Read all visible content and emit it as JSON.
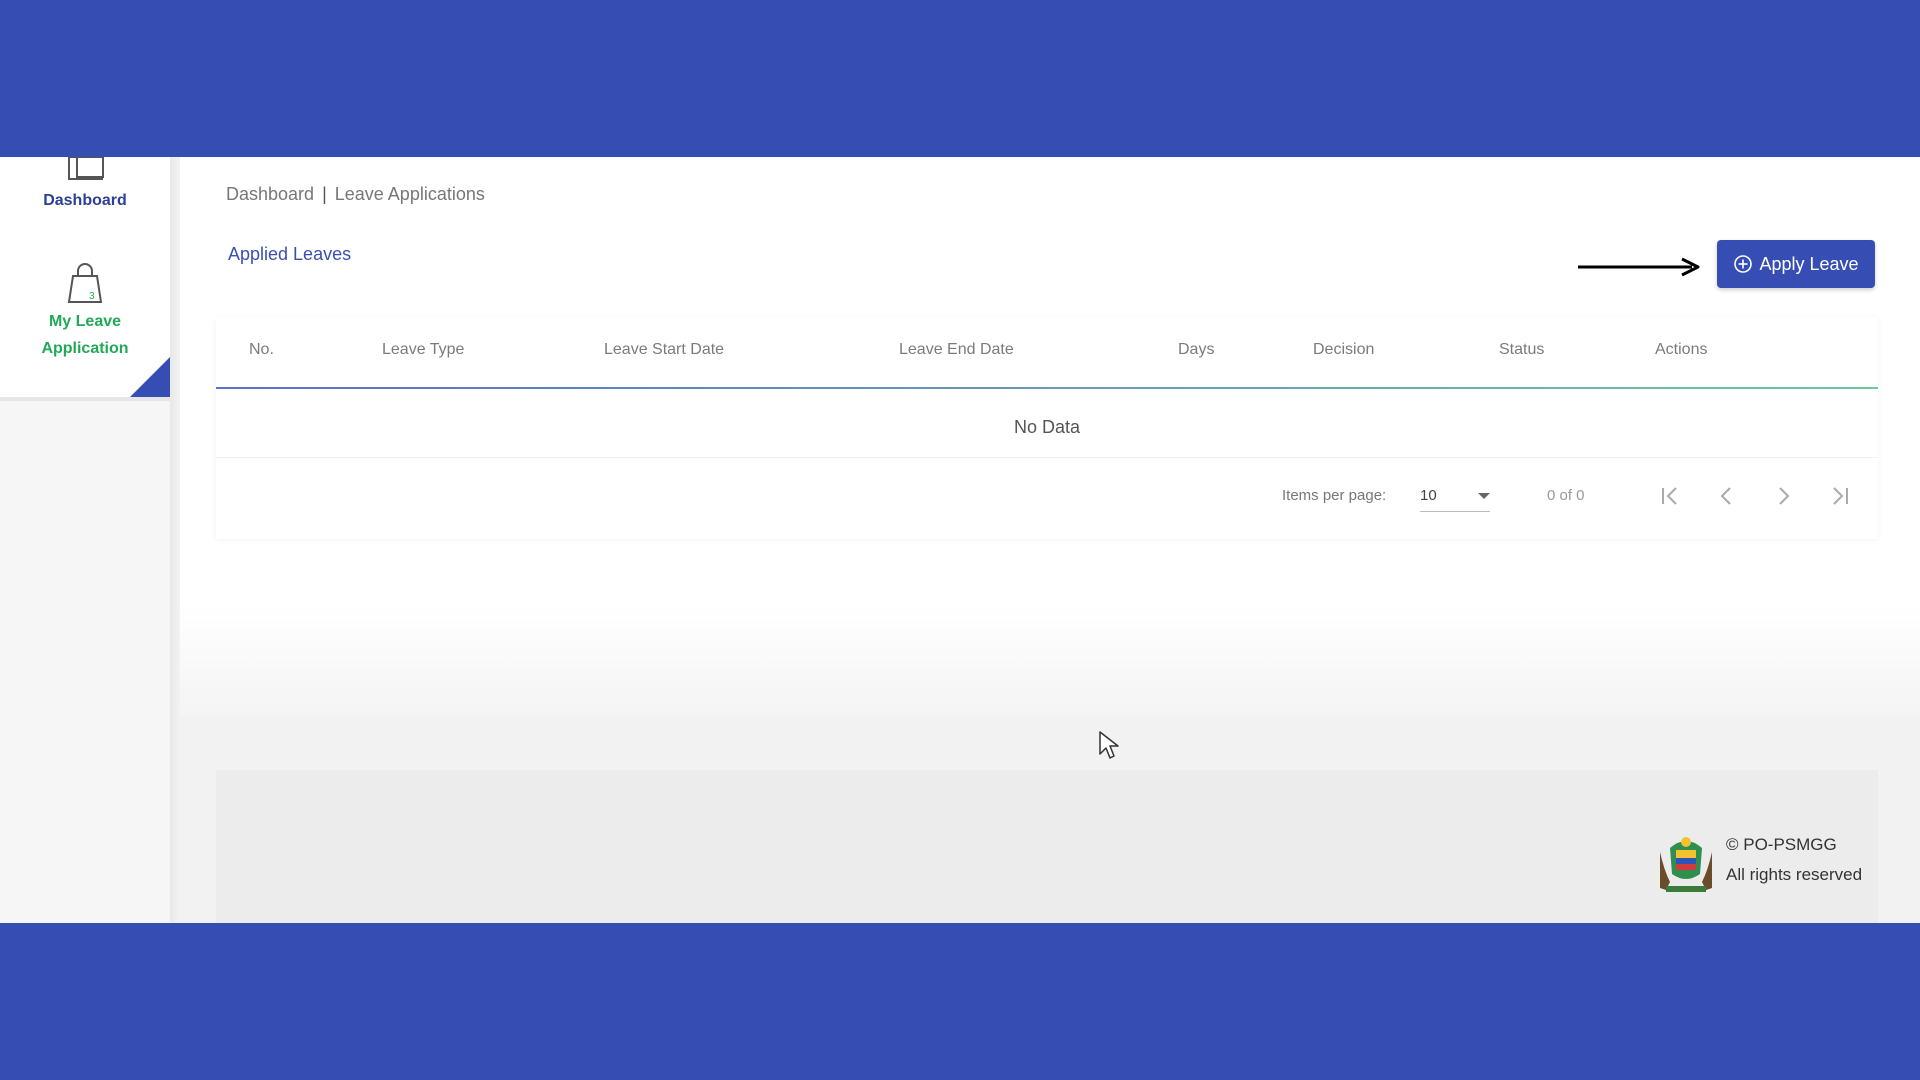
{
  "sidebar": {
    "items": [
      {
        "label": "Dashboard",
        "icon": "dashboard-icon",
        "color": "#2d3f99"
      },
      {
        "label": "My Leave Application",
        "label_line1": "My Leave",
        "label_line2": "Application",
        "icon": "bag-icon",
        "color": "#22a957",
        "active": true
      }
    ]
  },
  "breadcrumb": {
    "home": "Dashboard",
    "separator": "|",
    "current": "Leave Applications"
  },
  "section_title": "Applied Leaves",
  "apply_button": {
    "label": "Apply Leave",
    "icon": "plus-circle-icon",
    "color": "#364db4"
  },
  "table": {
    "columns": [
      "No.",
      "Leave Type",
      "Leave Start Date",
      "Leave End Date",
      "Days",
      "Decision",
      "Status",
      "Actions"
    ],
    "rows": [],
    "empty_text": "No Data"
  },
  "pagination": {
    "items_per_page_label": "Items per page:",
    "items_per_page": "10",
    "range": "0 of 0"
  },
  "footer": {
    "copyright": "© PO-PSMGG",
    "rights": "All rights reserved"
  },
  "colors": {
    "brand": "#364db4",
    "active": "#22a957"
  }
}
